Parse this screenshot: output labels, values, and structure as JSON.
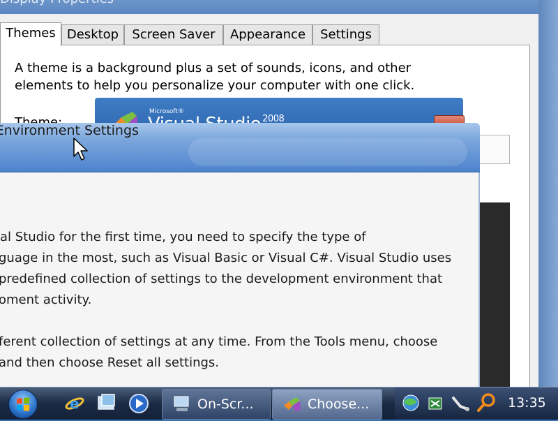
{
  "display_properties": {
    "title": "Display Properties",
    "tabs": [
      {
        "label": "Themes",
        "active": true
      },
      {
        "label": "Desktop",
        "active": false
      },
      {
        "label": "Screen Saver",
        "active": false
      },
      {
        "label": "Appearance",
        "active": false
      },
      {
        "label": "Settings",
        "active": false
      }
    ],
    "description": "A theme is a background plus a set of sounds, icons, and other elements to help you personalize your computer with one click.",
    "theme_label": "Theme:"
  },
  "vs_splash": {
    "brand": "Microsoft®",
    "product": "Visual Studio",
    "year": "2008"
  },
  "dialog": {
    "title": "Choose Default Environment Settings",
    "lines": [
      "al Studio for the first time, you need to specify the type of",
      "guage in the most, such as Visual Basic or Visual C#. Visual Studio uses",
      "predefined collection of settings to the development environment that",
      "oment activity.",
      "ferent collection of settings at any time. From the Tools menu, choose",
      "and then choose Reset all settings."
    ]
  },
  "taskbar": {
    "buttons": [
      {
        "label": "On-Scr...",
        "icon": "on-screen-keyboard-icon",
        "active": false
      },
      {
        "label": "Choose...",
        "icon": "visual-studio-icon",
        "active": true
      }
    ],
    "clock": "13:35",
    "quick_launch": [
      "internet-explorer-icon",
      "show-desktop-icon",
      "media-player-icon"
    ],
    "tray": [
      "network-globe-icon",
      "safely-remove-hardware-icon",
      "usb-device-icon",
      "search-magnifier-icon"
    ]
  }
}
